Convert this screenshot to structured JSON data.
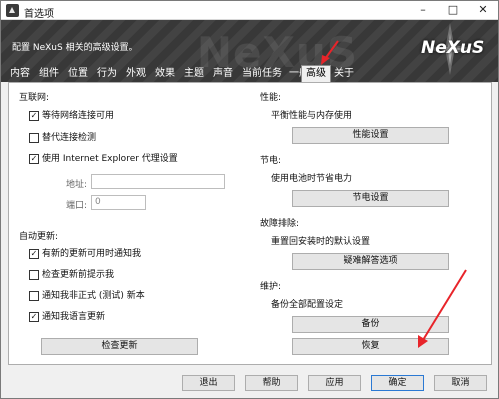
{
  "window": {
    "title": "首选项",
    "minimize_glyph": "–",
    "maximize_glyph": "□",
    "close_glyph": "✕"
  },
  "header": {
    "description": "配置 NeXuS 相关的高级设置。",
    "logo_text": "NeXuS",
    "watermark": "NeXuS",
    "background_color": "#3c3c3c"
  },
  "tabs": [
    {
      "label": "内容"
    },
    {
      "label": "组件"
    },
    {
      "label": "位置"
    },
    {
      "label": "行为"
    },
    {
      "label": "外观"
    },
    {
      "label": "效果"
    },
    {
      "label": "主题"
    },
    {
      "label": "声音"
    },
    {
      "label": "当前任务"
    },
    {
      "label": "一般"
    },
    {
      "label": "高级",
      "active": true
    },
    {
      "label": "关于"
    }
  ],
  "internet": {
    "group_label": "互联网:",
    "wait_network": {
      "label": "等待网络连接可用",
      "checked": true
    },
    "alt_detect": {
      "label": "替代连接检测",
      "checked": false
    },
    "use_ie_proxy": {
      "label": "使用 Internet Explorer 代理设置",
      "checked": true
    },
    "address_label": "地址:",
    "address_value": "",
    "port_label": "端口:",
    "port_value": "0"
  },
  "auto_update": {
    "group_label": "自动更新:",
    "notify_new": {
      "label": "有新的更新可用时通知我",
      "checked": true
    },
    "check_before": {
      "label": "检查更新前提示我",
      "checked": false
    },
    "notify_beta": {
      "label": "通知我非正式 (测试) 新本",
      "checked": false
    },
    "notify_lang": {
      "label": "通知我语言更新",
      "checked": true
    },
    "check_button": "检查更新"
  },
  "performance": {
    "group_label": "性能:",
    "text": "平衡性能与内存使用",
    "button": "性能设置"
  },
  "power": {
    "group_label": "节电:",
    "text": "使用电池时节省电力",
    "button": "节电设置"
  },
  "troubleshoot": {
    "group_label": "故障排除:",
    "text": "重置回安装时的默认设置",
    "button": "疑难解答选项"
  },
  "maintenance": {
    "group_label": "维护:",
    "text": "备份全部配置设定",
    "backup_button": "备份",
    "restore_button": "恢复"
  },
  "footer": {
    "exit": "退出",
    "help": "帮助",
    "apply": "应用",
    "ok": "确定",
    "cancel": "取消"
  },
  "colors": {
    "annotation_arrow": "#e8242a",
    "default_button_border": "#2b79d3"
  }
}
